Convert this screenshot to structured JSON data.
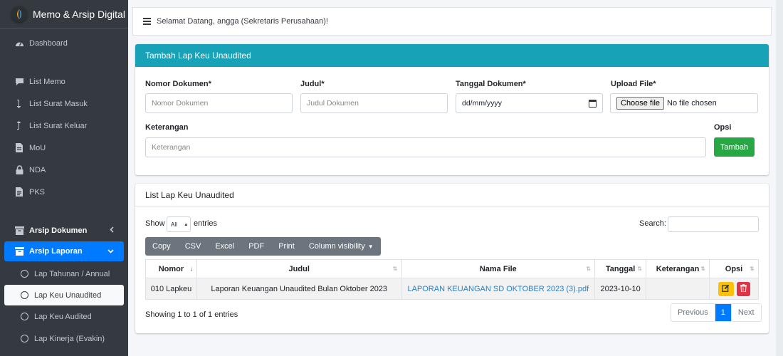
{
  "app": {
    "title": "Memo & Arsip Digital"
  },
  "topbar": {
    "welcome": "Selamat Datang, angga (Sekretaris Perusahaan)!"
  },
  "sidebar": {
    "items": [
      {
        "label": "Dashboard",
        "icon": "dashboard-icon"
      },
      {
        "label": "List Memo",
        "icon": "comment-icon"
      },
      {
        "label": "List Surat Masuk",
        "icon": "level-down-icon"
      },
      {
        "label": "List Surat Keluar",
        "icon": "level-up-icon"
      },
      {
        "label": "MoU",
        "icon": "file-icon"
      },
      {
        "label": "NDA",
        "icon": "lock-icon"
      },
      {
        "label": "PKS",
        "icon": "file-alt-icon"
      },
      {
        "label": "Arsip Dokumen",
        "icon": "archive-icon"
      },
      {
        "label": "Arsip Laporan",
        "icon": "archive-icon"
      },
      {
        "label": "Lap Tahunan / Annual",
        "icon": "circle-icon"
      },
      {
        "label": "Lap Keu Unaudited",
        "icon": "circle-icon"
      },
      {
        "label": "Lap Keu Audited",
        "icon": "circle-icon"
      },
      {
        "label": "Lap Kinerja (Evakin)",
        "icon": "circle-icon"
      }
    ]
  },
  "form": {
    "title": "Tambah Lap Keu Unaudited",
    "nomor_label": "Nomor Dokumen*",
    "nomor_placeholder": "Nomor Dokumen",
    "judul_label": "Judul*",
    "judul_placeholder": "Judul Dokumen",
    "tanggal_label": "Tanggal Dokumen*",
    "tanggal_value": "dd/mm/yyyy",
    "upload_label": "Upload File*",
    "choose_label": "Choose file",
    "no_file": "No file chosen",
    "keterangan_label": "Keterangan",
    "keterangan_placeholder": "Keterangan",
    "opsi_label": "Opsi",
    "tambah": "Tambah"
  },
  "list": {
    "title": "List Lap Keu Unaudited",
    "show": "Show",
    "entries_value": "All",
    "entries": "entries",
    "search": "Search:",
    "buttons": [
      "Copy",
      "CSV",
      "Excel",
      "PDF",
      "Print",
      "Column visibility"
    ],
    "columns": [
      "Nomor",
      "Judul",
      "Nama File",
      "Tanggal",
      "Keterangan",
      "Opsi"
    ],
    "rows": [
      {
        "nomor": "010 Lapkeu",
        "judul": "Laporan Keuangan Unaudited Bulan Oktober 2023",
        "nama_file": "LAPORAN KEUANGAN SD OKTOBER 2023 (3).pdf",
        "tanggal": "2023-10-10",
        "keterangan": ""
      }
    ],
    "info": "Showing 1 to 1 of 1 entries",
    "pager": {
      "previous": "Previous",
      "page": "1",
      "next": "Next"
    }
  },
  "colors": {
    "sidebar": "#343a40",
    "primary": "#007bff",
    "info": "#17a2b8",
    "success": "#28a745",
    "warning": "#ffc107",
    "danger": "#dc3545"
  }
}
